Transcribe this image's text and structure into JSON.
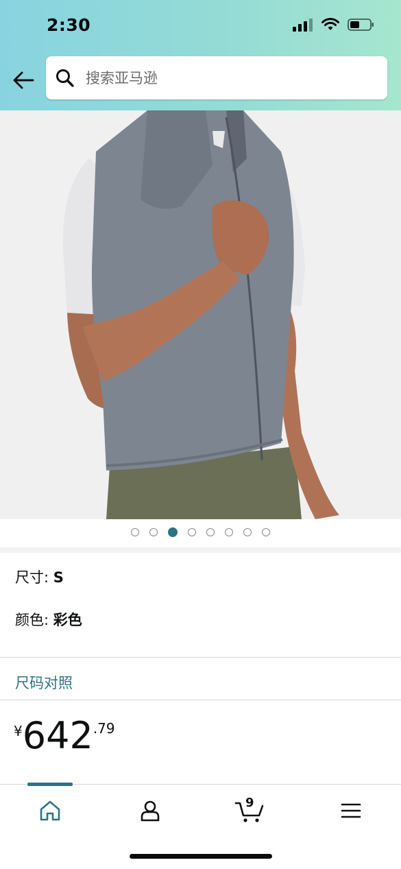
{
  "status_bar": {
    "time": "2:30"
  },
  "search": {
    "placeholder": "搜索亚马逊"
  },
  "carousel": {
    "total": 8,
    "active_index": 2
  },
  "options": {
    "size_label": "尺寸: ",
    "size_value": "S",
    "color_label": "颜色: ",
    "color_value": "彩色"
  },
  "size_chart_link": "尺码对照",
  "price": {
    "symbol": "¥",
    "whole": "642",
    "fraction": ".79"
  },
  "bottom_nav": {
    "cart_count": "9",
    "active": "home"
  },
  "colors": {
    "accent": "#2b7486",
    "header_start": "#88d3e0",
    "header_end": "#a6e6cf"
  }
}
